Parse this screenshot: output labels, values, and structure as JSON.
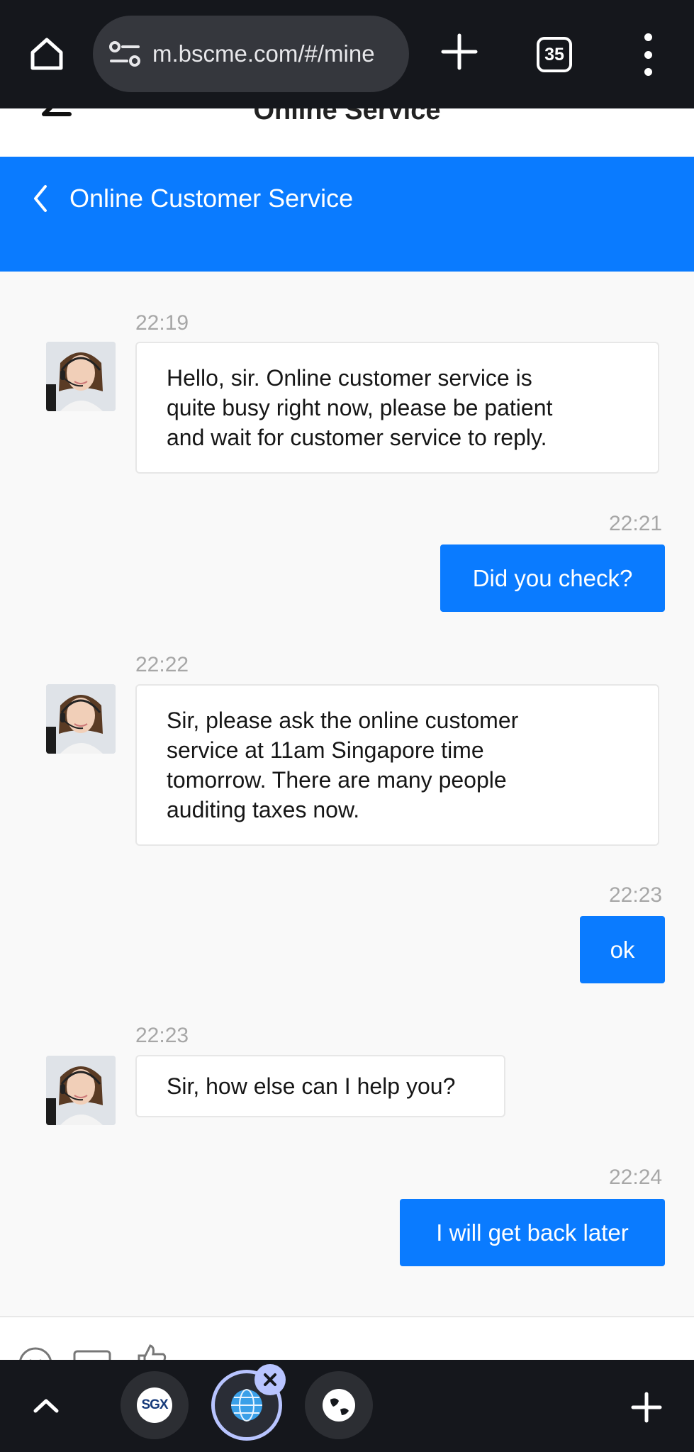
{
  "browser": {
    "url": "m.bscme.com/#/mine",
    "tab_count": "35"
  },
  "page_header": {
    "title": "Online Service"
  },
  "service_header": {
    "title": "Online Customer Service"
  },
  "chat": {
    "messages": [
      {
        "from": "agent",
        "time": "22:19",
        "lines": [
          "Hello, sir. Online customer service is",
          "quite busy right now, please be patient",
          "and wait for customer service to reply."
        ]
      },
      {
        "from": "user",
        "time": "22:21",
        "text": "Did you check?"
      },
      {
        "from": "agent",
        "time": "22:22",
        "lines": [
          "Sir, please ask the online customer",
          "service at 11am Singapore time",
          "tomorrow. There are many people",
          "auditing taxes now."
        ]
      },
      {
        "from": "user",
        "time": "22:23",
        "text": "ok"
      },
      {
        "from": "agent",
        "time": "22:23",
        "lines": [
          "Sir, how else can I help you?"
        ]
      },
      {
        "from": "user",
        "time": "22:24",
        "text": "I will get back later"
      }
    ]
  },
  "tab_bar": {
    "sgx_label": "SGX"
  },
  "colors": {
    "accent": "#0a7bff",
    "browser_chrome": "#15171c"
  }
}
